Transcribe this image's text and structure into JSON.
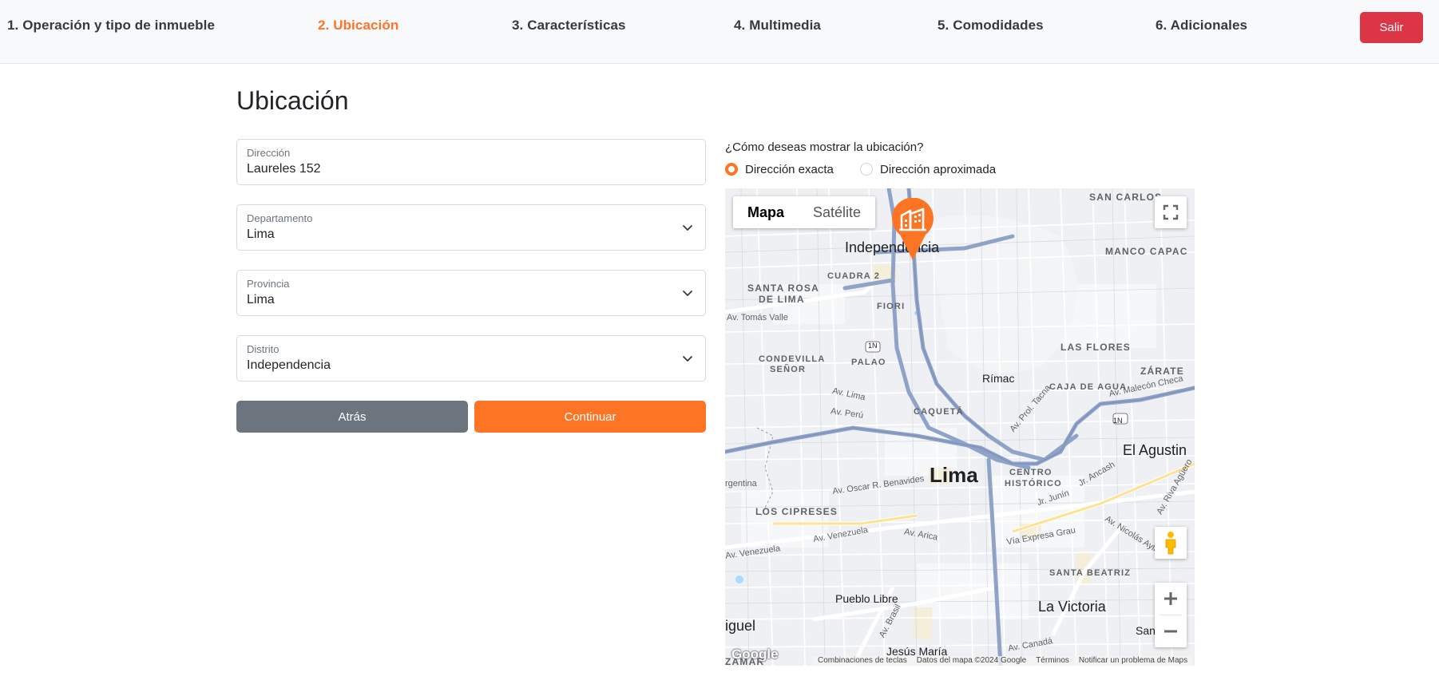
{
  "steps": [
    {
      "label": "1. Operación y tipo de inmueble"
    },
    {
      "label": "2. Ubicación"
    },
    {
      "label": "3. Características"
    },
    {
      "label": "4. Multimedia"
    },
    {
      "label": "5. Comodidades"
    },
    {
      "label": "6. Adicionales"
    }
  ],
  "active_step": 2,
  "logout_label": "Salir",
  "page_title": "Ubicación",
  "form": {
    "address": {
      "label": "Dirección",
      "value": "Laureles 152"
    },
    "department": {
      "label": "Departamento",
      "value": "Lima"
    },
    "province": {
      "label": "Provincia",
      "value": "Lima"
    },
    "district": {
      "label": "Distrito",
      "value": "Independencia"
    },
    "back_label": "Atrás",
    "continue_label": "Continuar"
  },
  "location_display": {
    "question": "¿Cómo deseas mostrar la ubicación?",
    "options": [
      {
        "label": "Dirección exacta",
        "checked": true
      },
      {
        "label": "Dirección aproximada",
        "checked": false
      }
    ]
  },
  "map": {
    "type_options": [
      "Mapa",
      "Satélite"
    ],
    "selected_type": "Mapa",
    "labels": {
      "san_carlos": "SAN CARLOS",
      "independencia": "Independencia",
      "manco_capac": "MANCO CAPAC",
      "cuadra_2": "CUADRA 2",
      "santa_rosa_1": "SANTA ROSA",
      "santa_rosa_2": "DE LIMA",
      "fiori": "FIORI",
      "tomas_valle": "Av. Tomás Valle",
      "route_1n_a": "1N",
      "route_1n_b": "1N",
      "condevilla_1": "CONDEVILLA",
      "condevilla_2": "SEÑOR",
      "palao": "PALAO",
      "las_flores": "LAS FLORES",
      "rimac": "Rímac",
      "zarate": "ZÁRATE",
      "caja_de_agua": "CAJA DE AGUA",
      "malecon_checa": "Av. Malecón Checa",
      "av_lima": "Av. Lima",
      "av_peru": "Av. Perú",
      "caqueta": "CAQUETÁ",
      "prol_tacna": "Av. Prol. Tacna",
      "el_agustino": "El Agustin",
      "lima": "Lima",
      "centro_1": "CENTRO",
      "centro_2": "HISTÓRICO",
      "ancash": "Jr. Ancash",
      "riva_aguero": "Av. Riva Agüero",
      "jr_junin": "Jr. Junín",
      "argentina": "rgentina",
      "oscar_benavides": "Av. Oscar R. Benavides",
      "los_cipreses": "LOS CIPRESES",
      "av_venezuela_1": "Av. Venezuela",
      "av_venezuela_2": "Av. Venezuela",
      "av_arica": "Av. Arica",
      "via_expresa_grau": "Vía Expresa Grau",
      "nicolas_ayllon": "Av. Nicolás Ayllón",
      "santa_beatriz": "SANTA BEATRIZ",
      "pueblo_libre": "Pueblo Libre",
      "la_victoria": "La Victoria",
      "san_miguel": "iguel",
      "av_brasil": "Av. Brasil",
      "jesus_maria": "Jesús María",
      "av_canada": "Av. Canadá",
      "san_partial": "San",
      "zamar": "ZAMAR"
    },
    "google_logo": "Google",
    "attribution": [
      "Combinaciones de teclas",
      "Datos del mapa ©2024 Google",
      "Términos",
      "Notificar un problema de Maps"
    ],
    "zoom_in": "+",
    "zoom_out": "−",
    "colors": {
      "accent": "#fd7424",
      "danger": "#dc3545",
      "secondary": "#6c757d",
      "highway": "#8fa3c8"
    }
  }
}
